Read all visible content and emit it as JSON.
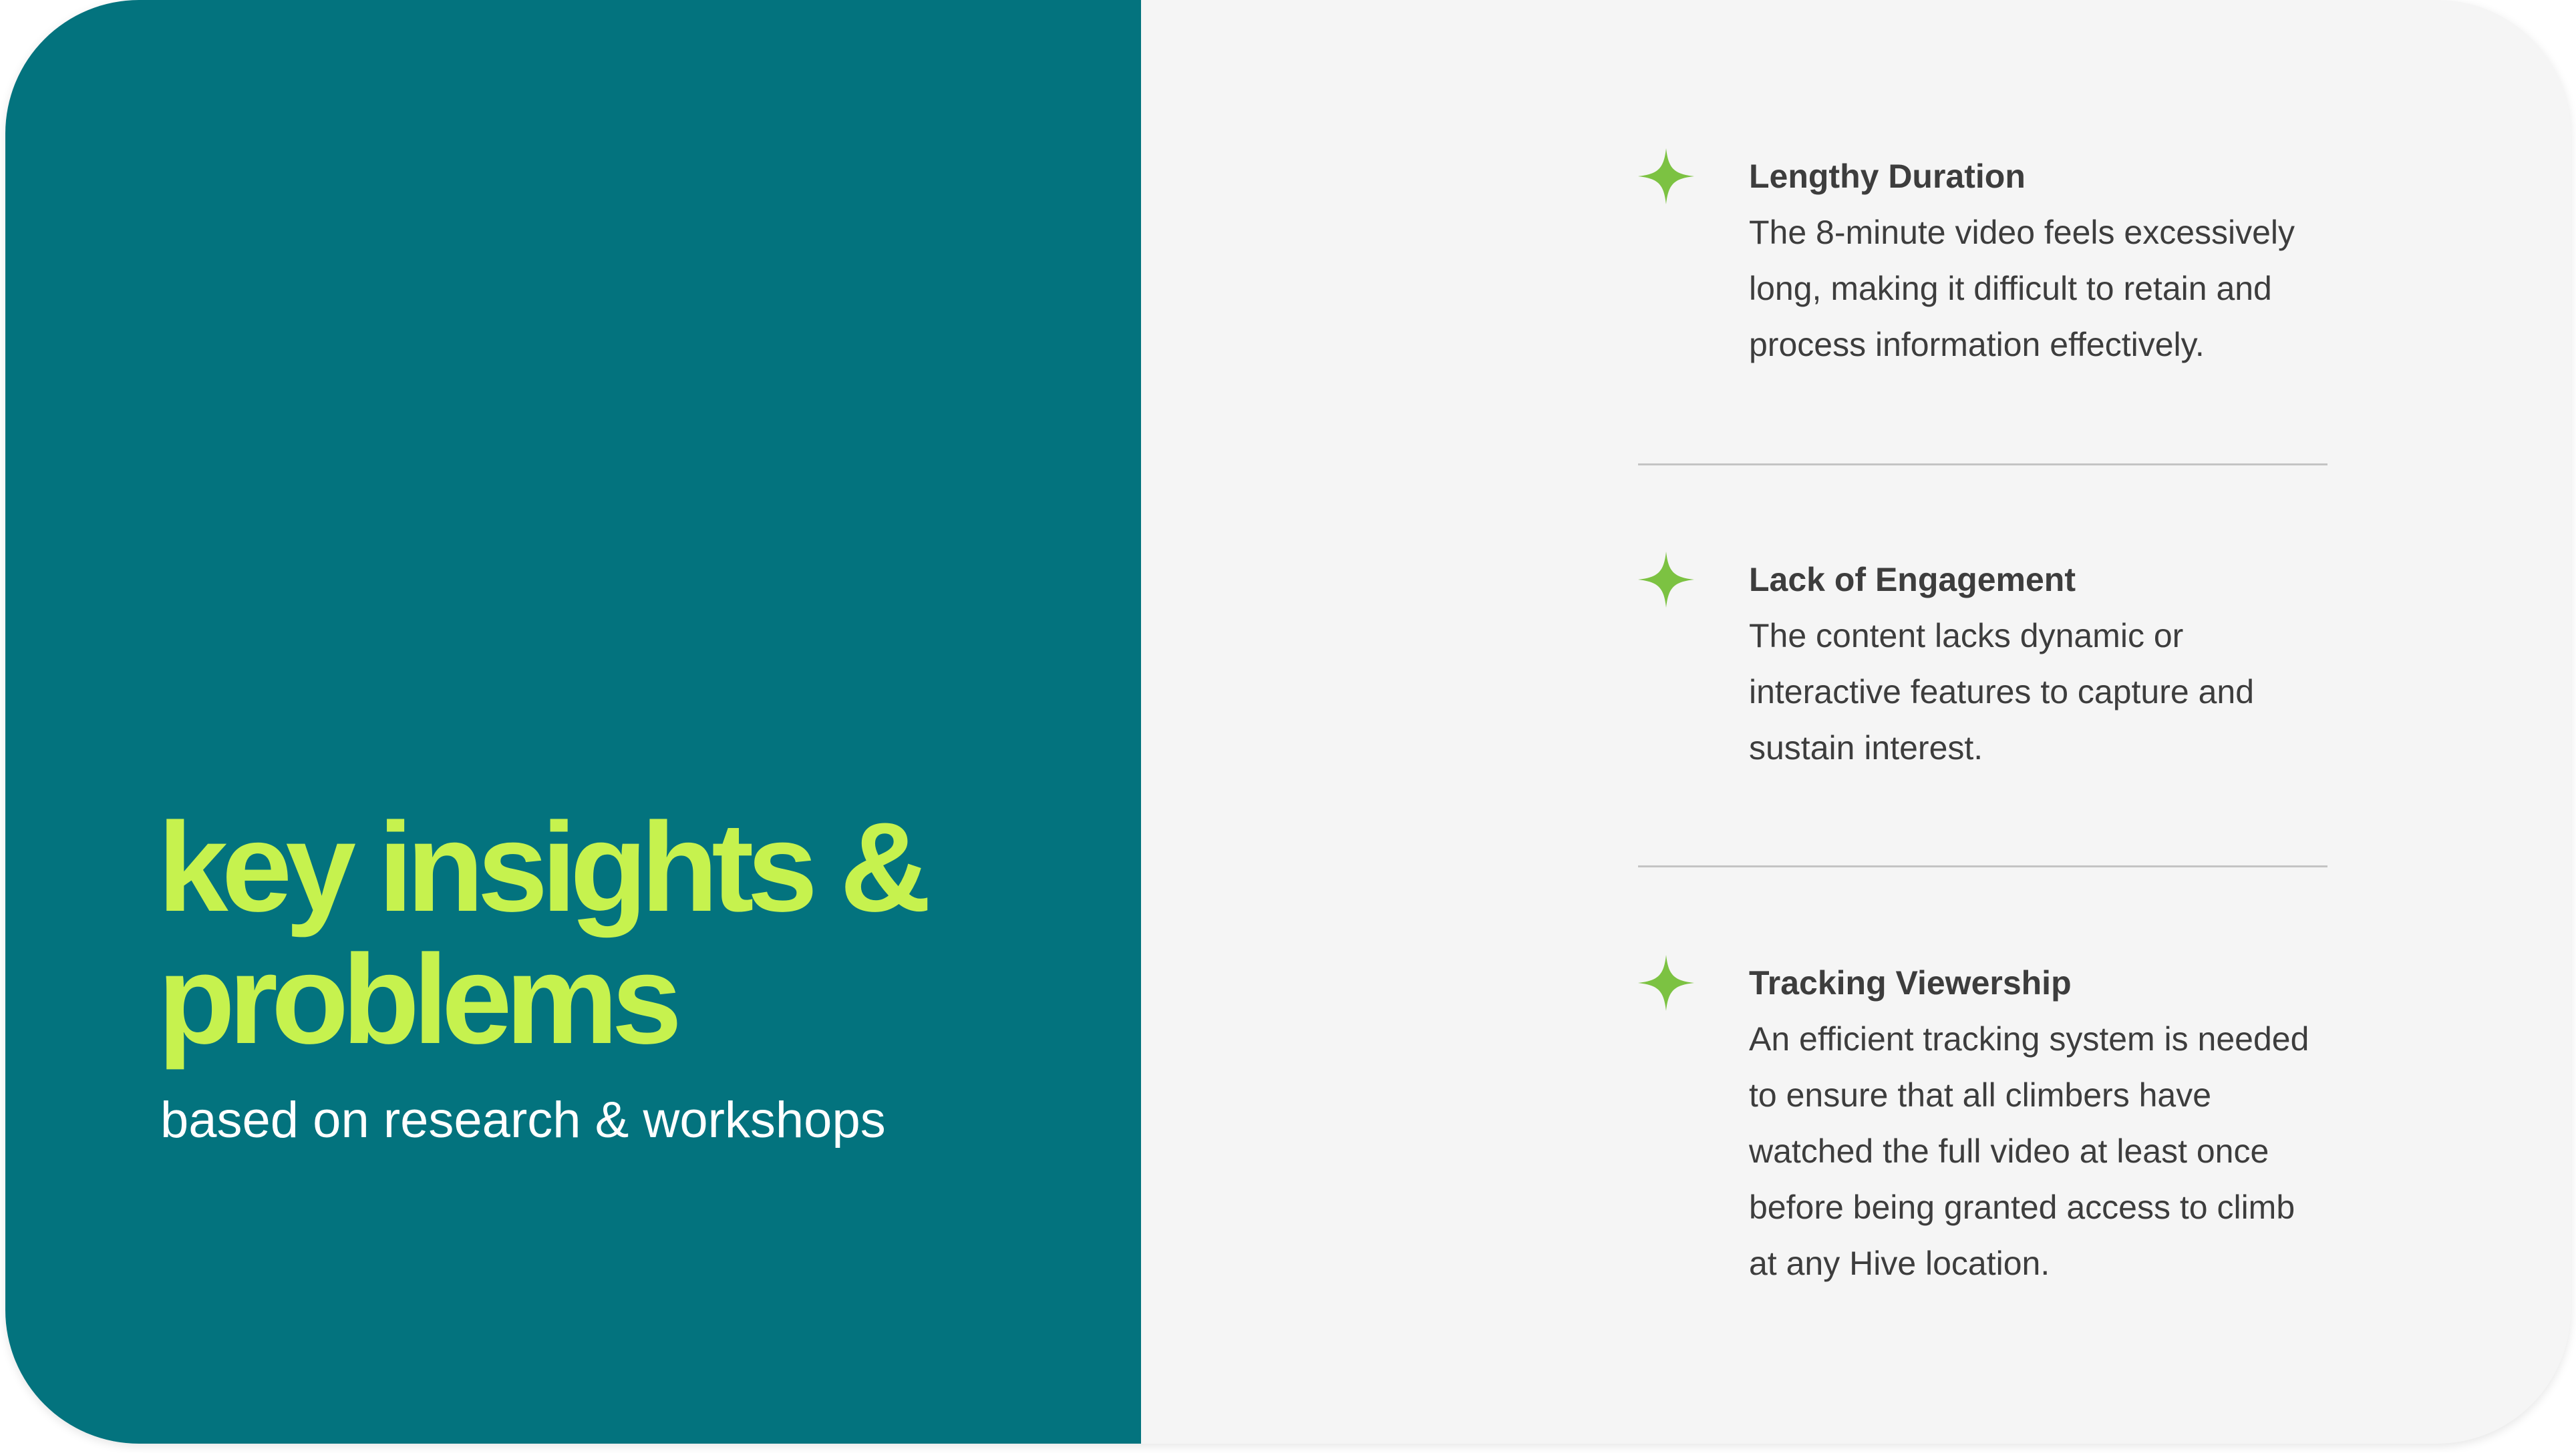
{
  "hero": {
    "title_lines": [
      "key insights &",
      "problems"
    ],
    "subtitle": "based on research & workshops"
  },
  "insights": [
    {
      "icon": "sparkle-icon",
      "title": "Lengthy Duration",
      "lines": [
        "The 8-minute video feels excessively",
        "long, making it difficult to retain and",
        "process information effectively."
      ]
    },
    {
      "icon": "sparkle-icon",
      "title": "Lack of Engagement",
      "lines": [
        "The content lacks dynamic or",
        "interactive features to capture and",
        "sustain interest."
      ]
    },
    {
      "icon": "sparkle-icon",
      "title": "Tracking Viewership",
      "lines": [
        "An efficient tracking system is needed",
        "to ensure that all climbers have",
        "watched the full video at least once",
        "before being granted access to climb",
        "at any Hive location."
      ]
    }
  ],
  "colors": {
    "panel": "#03737e",
    "accent": "#c6f24e",
    "sparkle": "#7cc242",
    "background": "#f5f5f5",
    "text": "#3d3d3d",
    "divider": "#c4c4c4"
  }
}
